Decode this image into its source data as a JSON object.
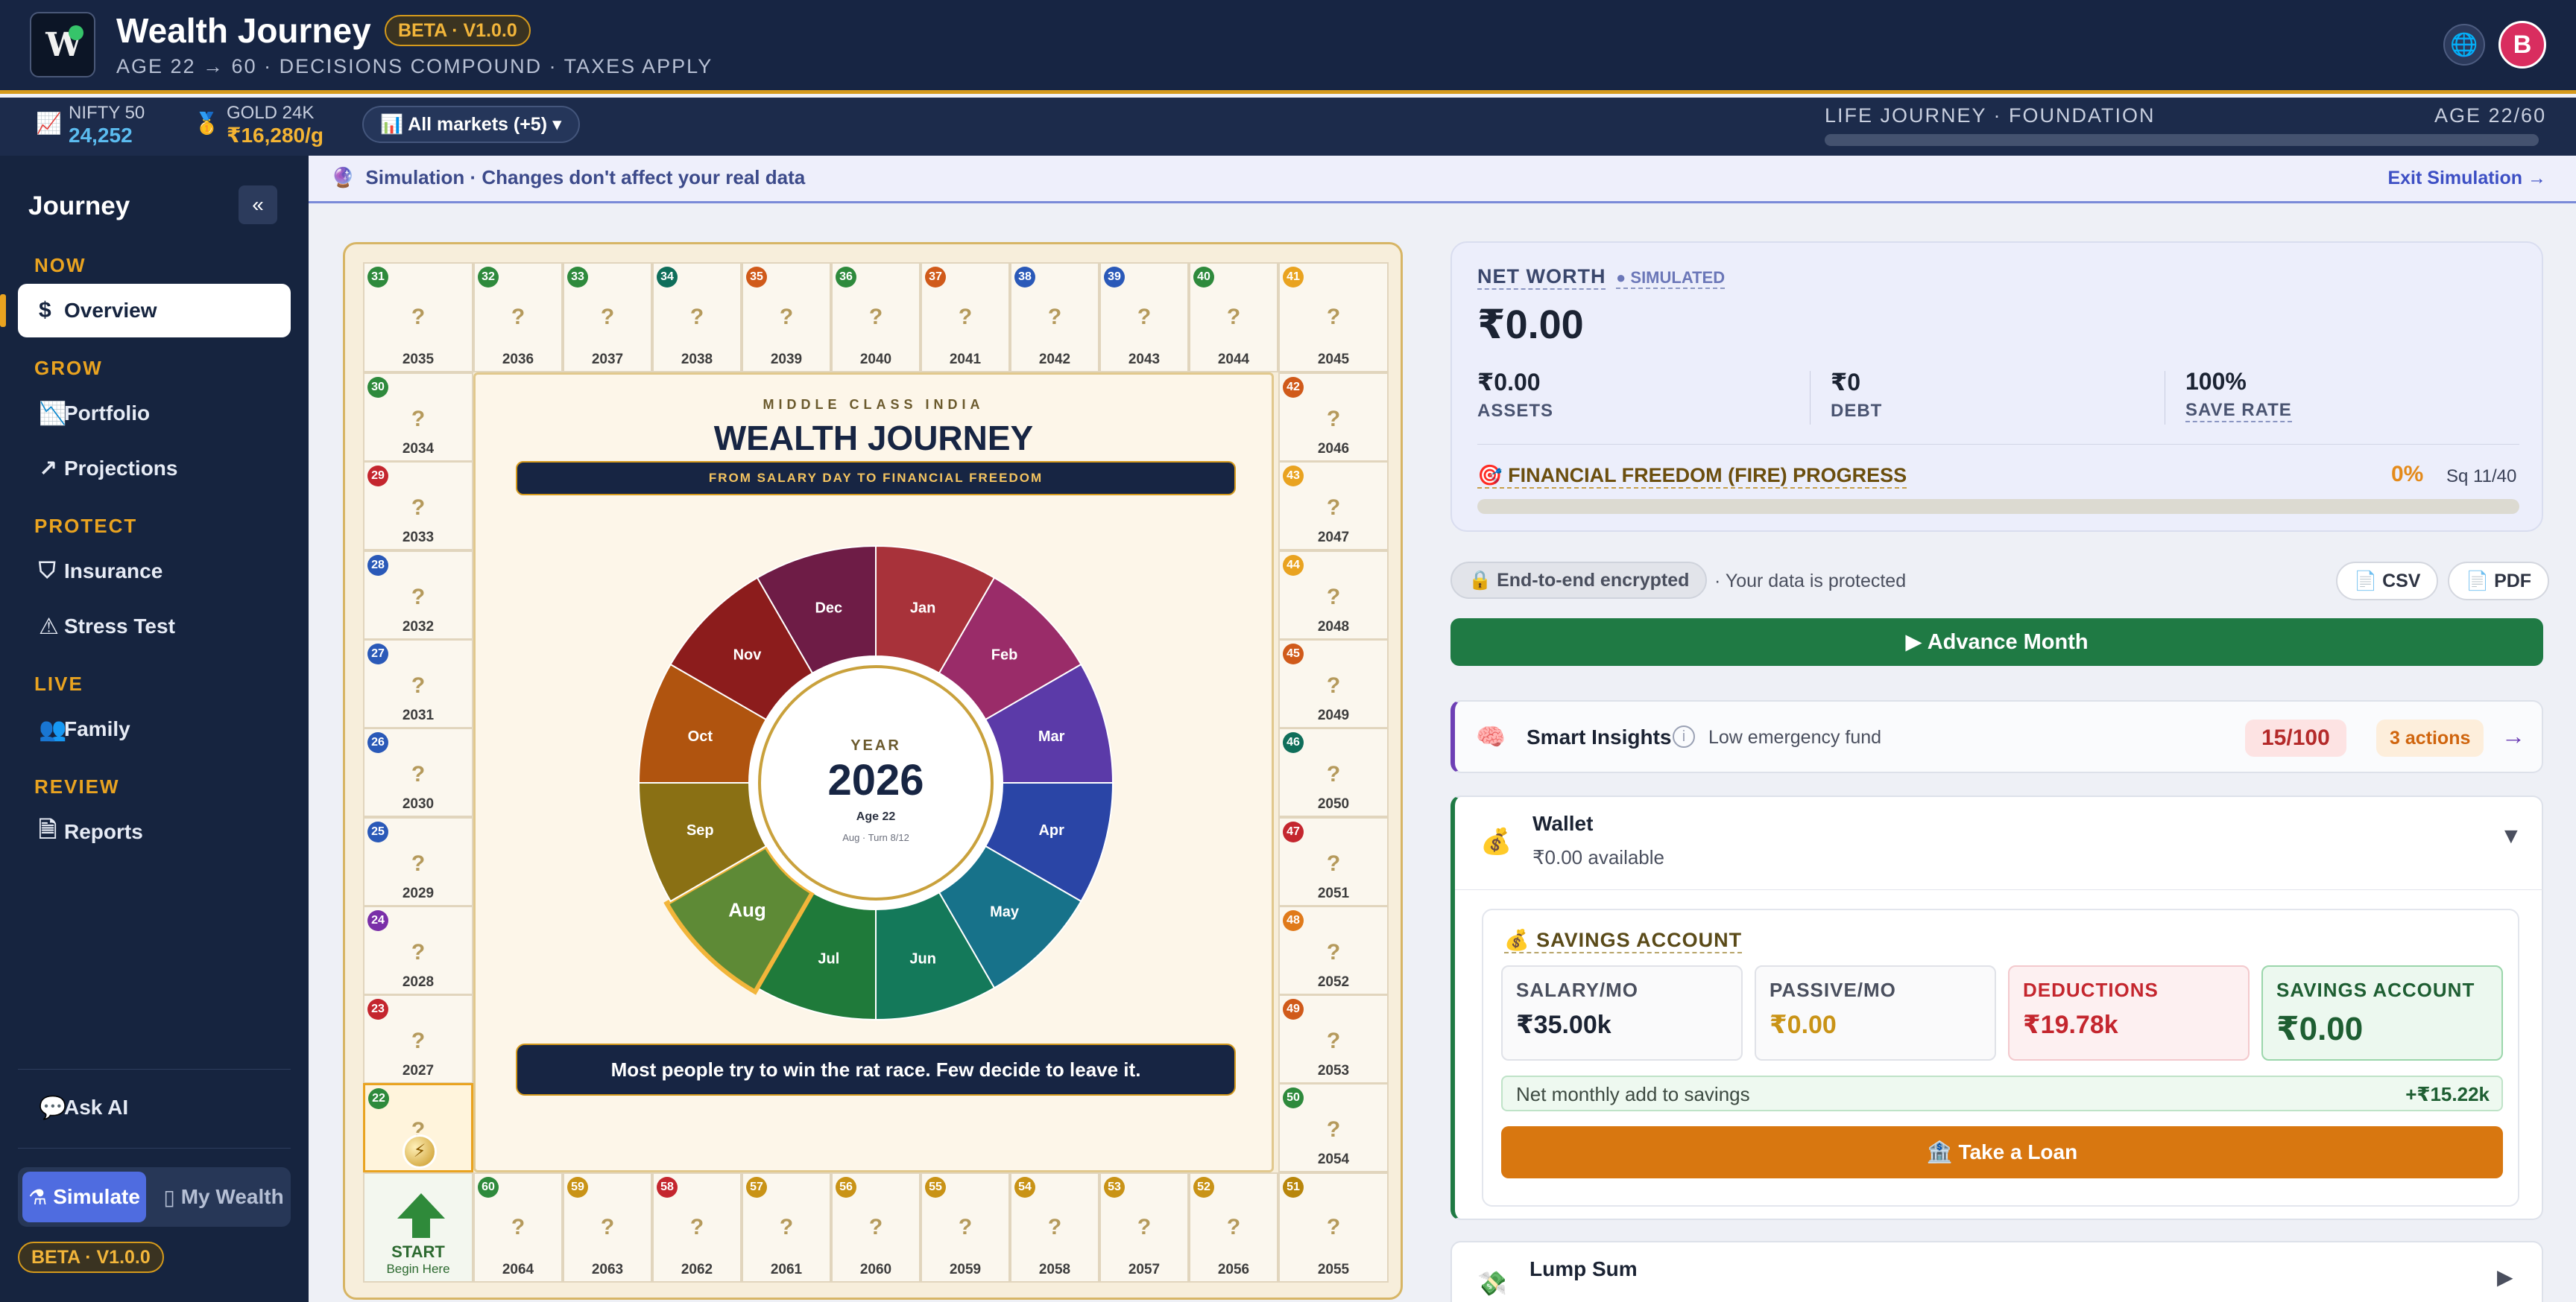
{
  "header": {
    "logo_text": "W",
    "title": "Wealth Journey",
    "beta": "BETA · V1.0.0",
    "subtitle": "AGE 22 → 60 · DECISIONS COMPOUND · TAXES APPLY",
    "avatar_initial": "B"
  },
  "ticker": {
    "nifty_label": "NIFTY 50",
    "nifty_value": "24,252",
    "gold_label": "GOLD 24K",
    "gold_value": "₹16,280/g",
    "markets_label": "📊 All markets (+5) ▾",
    "journey_label": "LIFE JOURNEY · FOUNDATION",
    "age_label": "AGE 22/60",
    "journey_progress": 0.0
  },
  "sidebar": {
    "title": "Journey",
    "collapse": "«",
    "sections": {
      "now": "NOW",
      "grow": "GROW",
      "protect": "PROTECT",
      "live": "LIVE",
      "review": "REVIEW"
    },
    "items": {
      "overview": "Overview",
      "portfolio": "Portfolio",
      "projections": "Projections",
      "insurance": "Insurance",
      "stress": "Stress Test",
      "family": "Family",
      "reports": "Reports",
      "ask_ai": "Ask AI"
    },
    "mode_simulate": "Simulate",
    "mode_wealth": "My Wealth",
    "beta": "BETA · V1.0.0"
  },
  "banner": {
    "text": "Simulation · Changes don't affect your real data",
    "exit": "Exit Simulation →"
  },
  "board": {
    "kicker": "MIDDLE CLASS INDIA",
    "title": "WEALTH JOURNEY",
    "ribbon": "FROM SALARY DAY TO FINANCIAL FREEDOM",
    "year_label": "YEAR",
    "year": "2026",
    "age": "Age 22",
    "turn": "Aug · Turn 8/12",
    "quote": "Most people try to win the rat race. Few decide to leave it.",
    "start_label": "START",
    "start_sub": "Begin Here",
    "unknown": "?",
    "months": [
      "Jan",
      "Feb",
      "Mar",
      "Apr",
      "May",
      "Jun",
      "Jul",
      "Aug",
      "Sep",
      "Oct",
      "Nov",
      "Dec"
    ],
    "month_colors": [
      "#a8323a",
      "#9a2c69",
      "#5b3aa8",
      "#2a45a6",
      "#17728a",
      "#14795a",
      "#1f7a3a",
      "#5e8a36",
      "#8a7014",
      "#b0540f",
      "#8c1c1c",
      "#6e1c46"
    ],
    "current_month": "Aug",
    "top_row": [
      {
        "n": 31,
        "y": "2035",
        "c": "#2e8a3c"
      },
      {
        "n": 32,
        "y": "2036",
        "c": "#2e8a3c"
      },
      {
        "n": 33,
        "y": "2037",
        "c": "#2e8a3c"
      },
      {
        "n": 34,
        "y": "2038",
        "c": "#0f6e5a"
      },
      {
        "n": 35,
        "y": "2039",
        "c": "#d05a1a"
      },
      {
        "n": 36,
        "y": "2040",
        "c": "#2e8a3c"
      },
      {
        "n": 37,
        "y": "2041",
        "c": "#d05a1a"
      },
      {
        "n": 38,
        "y": "2042",
        "c": "#2a59b8"
      },
      {
        "n": 39,
        "y": "2043",
        "c": "#2a59b8"
      },
      {
        "n": 40,
        "y": "2044",
        "c": "#2e8a3c"
      },
      {
        "n": 41,
        "y": "2045",
        "c": "#e9a320"
      }
    ],
    "left_col": [
      {
        "n": 30,
        "y": "2034",
        "c": "#2e8a3c"
      },
      {
        "n": 29,
        "y": "2033",
        "c": "#c4262e"
      },
      {
        "n": 28,
        "y": "2032",
        "c": "#2a59b8"
      },
      {
        "n": 27,
        "y": "2031",
        "c": "#2a59b8"
      },
      {
        "n": 26,
        "y": "2030",
        "c": "#2a59b8"
      },
      {
        "n": 25,
        "y": "2029",
        "c": "#2a59b8"
      },
      {
        "n": 24,
        "y": "2028",
        "c": "#7a2fa8"
      },
      {
        "n": 23,
        "y": "2027",
        "c": "#c4262e"
      },
      {
        "n": 22,
        "y": "",
        "c": "#2e8a3c"
      }
    ],
    "right_col": [
      {
        "n": 42,
        "y": "2046",
        "c": "#d05a1a"
      },
      {
        "n": 43,
        "y": "2047",
        "c": "#e9a320"
      },
      {
        "n": 44,
        "y": "2048",
        "c": "#e9a320"
      },
      {
        "n": 45,
        "y": "2049",
        "c": "#d05a1a"
      },
      {
        "n": 46,
        "y": "2050",
        "c": "#0f6e5a"
      },
      {
        "n": 47,
        "y": "2051",
        "c": "#c4262e"
      },
      {
        "n": 48,
        "y": "2052",
        "c": "#e07a1a"
      },
      {
        "n": 49,
        "y": "2053",
        "c": "#d05a1a"
      },
      {
        "n": 50,
        "y": "2054",
        "c": "#2e8a3c"
      }
    ],
    "bottom_row": [
      {
        "n": 60,
        "y": "2064",
        "c": "#2e8a3c"
      },
      {
        "n": 59,
        "y": "2063",
        "c": "#c99316"
      },
      {
        "n": 58,
        "y": "2062",
        "c": "#c4262e"
      },
      {
        "n": 57,
        "y": "2061",
        "c": "#c99316"
      },
      {
        "n": 56,
        "y": "2060",
        "c": "#c99316"
      },
      {
        "n": 55,
        "y": "2059",
        "c": "#c99316"
      },
      {
        "n": 54,
        "y": "2058",
        "c": "#c99316"
      },
      {
        "n": 53,
        "y": "2057",
        "c": "#c99316"
      },
      {
        "n": 52,
        "y": "2056",
        "c": "#c99316"
      },
      {
        "n": 51,
        "y": "2055",
        "c": "#b8860b"
      }
    ]
  },
  "networth": {
    "label": "NET WORTH",
    "simulated": "● SIMULATED",
    "value": "₹0.00",
    "assets": "₹0.00",
    "assets_label": "ASSETS",
    "debt": "₹0",
    "debt_label": "DEBT",
    "save_rate": "100%",
    "save_rate_label": "SAVE RATE",
    "fire_label": "🎯 FINANCIAL FREEDOM (FIRE) PROGRESS",
    "fire_pct": "0%",
    "fire_sq": "Sq 11/40"
  },
  "actions": {
    "encrypted": "🔒 End-to-end encrypted",
    "protected": "· Your data is protected",
    "csv": "📄 CSV",
    "pdf": "📄 PDF",
    "advance": "▶ Advance Month"
  },
  "insights": {
    "title": "Smart Insights",
    "message": "Low emergency fund",
    "score": "15/100",
    "actions": "3 actions",
    "arrow": "→"
  },
  "wallet": {
    "title": "Wallet",
    "available": "₹0.00 available",
    "chevron": "▼",
    "savings_title": "💰 SAVINGS ACCOUNT",
    "salary_label": "SALARY/MO",
    "salary": "₹35.00k",
    "passive_label": "PASSIVE/MO",
    "passive": "₹0.00",
    "deductions_label": "DEDUCTIONS",
    "deductions": "₹19.78k",
    "savings_label": "SAVINGS ACCOUNT",
    "savings": "₹0.00",
    "net_label": "Net monthly add to savings",
    "net_value": "+₹15.22k",
    "loan": "🏦 Take a Loan"
  },
  "lump": {
    "title": "Lump Sum",
    "chevron": "▶"
  }
}
